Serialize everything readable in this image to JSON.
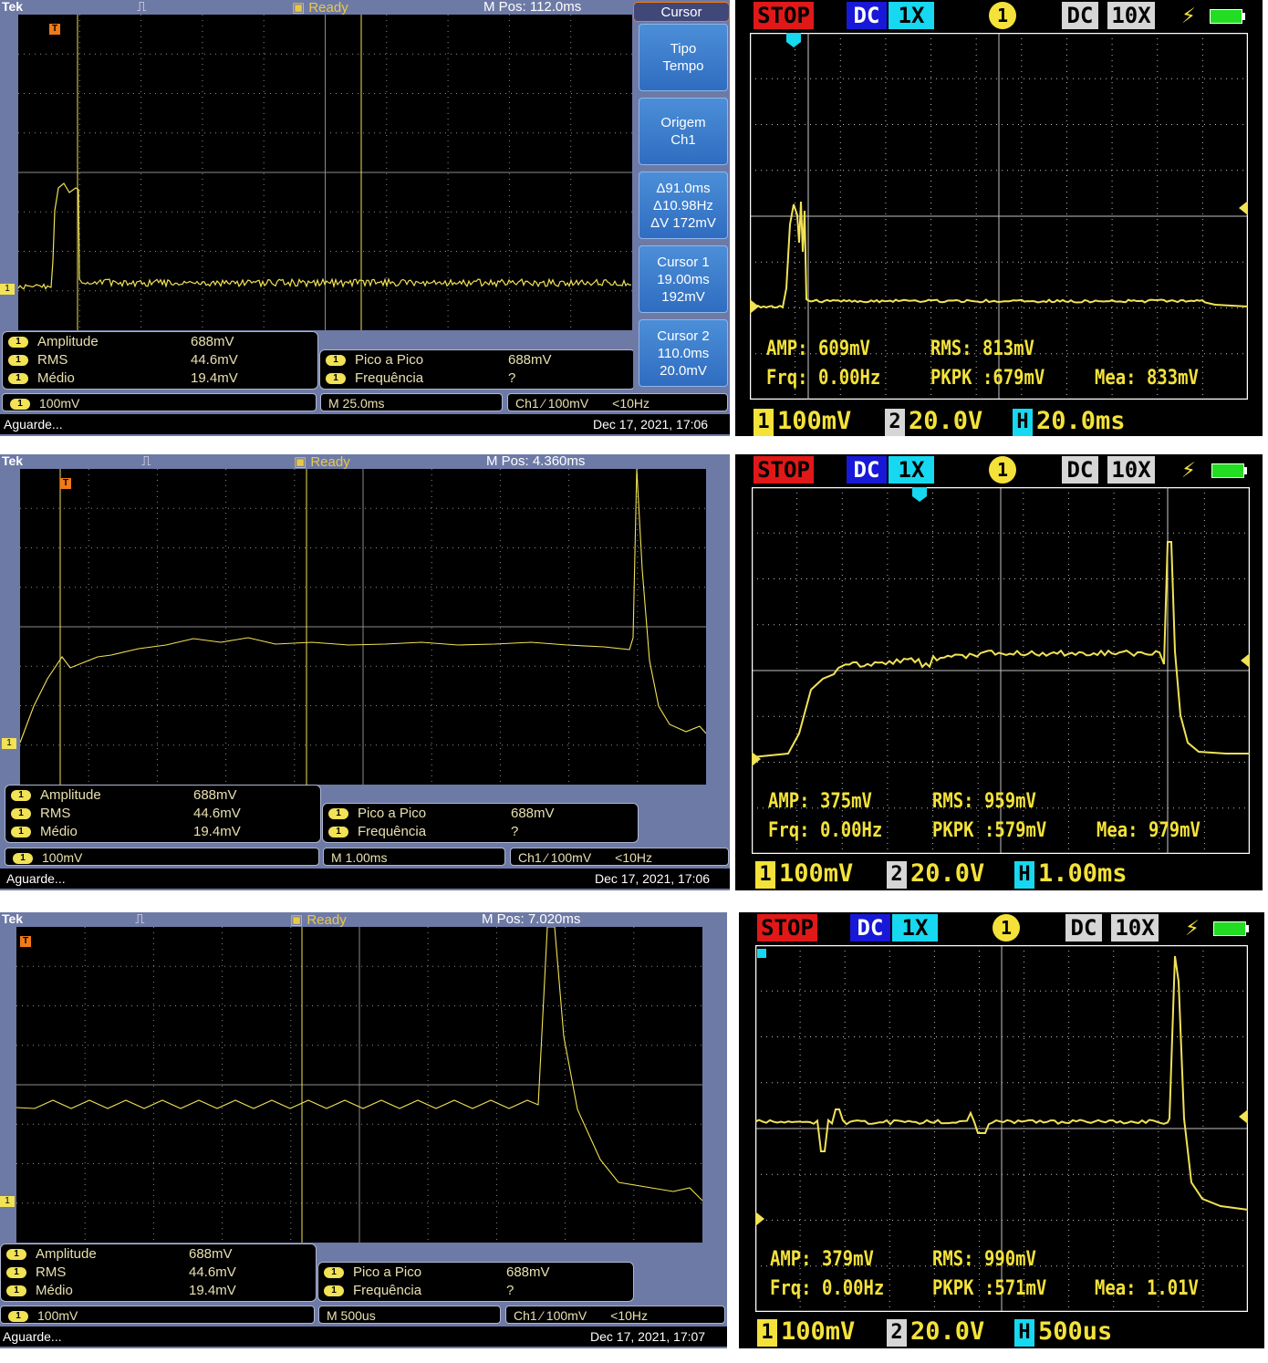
{
  "colors": {
    "trace": "#f1e256",
    "tek_frame": "#6e7aa6",
    "cursor_orange": "#f07a18",
    "dso_stop": "#e01818",
    "dso_dc": "#1818d8",
    "dso_x1": "#16d8f0"
  },
  "tek_shared": {
    "brand": "Tek",
    "trigger_state": "Ready",
    "ch1_marker": "1",
    "trigger_marker": "T",
    "measurements": [
      {
        "ch": "1",
        "label": "Amplitude",
        "value": "688mV"
      },
      {
        "ch": "1",
        "label": "RMS",
        "value": "44.6mV"
      },
      {
        "ch": "1",
        "label": "Médio",
        "value": "19.4mV"
      }
    ],
    "measurements2": [
      {
        "ch": "1",
        "label": "Pico a Pico",
        "value": "688mV"
      },
      {
        "ch": "1",
        "label": "Frequência",
        "value": "?"
      }
    ],
    "ch1_scale": "100mV",
    "trigger_info": "Ch1 ⁄ 100mV",
    "trigger_freq": "<10Hz",
    "status_msg": "Aguarde..."
  },
  "tek_panels": [
    {
      "mpos": "M Pos: 112.0ms",
      "timebase": "M 25.0ms",
      "datetime": "Dec 17, 2021, 17:06"
    },
    {
      "mpos": "M Pos: 4.360ms",
      "timebase": "M 1.00ms",
      "datetime": "Dec 17, 2021, 17:06"
    },
    {
      "mpos": "M Pos: 7.020ms",
      "timebase": "M 500us",
      "datetime": "Dec 17, 2021, 17:07"
    }
  ],
  "cursor_menu": {
    "title": "Cursor",
    "type": [
      "Tipo",
      "Tempo"
    ],
    "source": [
      "Origem",
      "Ch1"
    ],
    "delta": [
      "Δ91.0ms",
      "Δ10.98Hz",
      "ΔV 172mV"
    ],
    "cursor1": [
      "Cursor 1",
      "19.00ms",
      "192mV"
    ],
    "cursor2": [
      "Cursor 2",
      "110.0ms",
      "20.0mV"
    ]
  },
  "dso_shared": {
    "stop": "STOP",
    "coupling": "DC",
    "probe": "1X",
    "channel": "1",
    "coupling2": "DC",
    "probe2": "10X",
    "trigger_edge": "⚡",
    "ch1_box": "1",
    "ch2_box": "2",
    "h_box": "H"
  },
  "dso_panels": [
    {
      "amp": "AMP: 609mV",
      "rms": "RMS: 813mV",
      "frq": "Frq: 0.00Hz",
      "pkpk": "PKPK :679mV",
      "mea": "Mea: 833mV",
      "ch1": "100mV",
      "ch2": "20.0V",
      "h": "20.0ms"
    },
    {
      "amp": "AMP: 375mV",
      "rms": "RMS: 959mV",
      "frq": "Frq: 0.00Hz",
      "pkpk": "PKPK :579mV",
      "mea": "Mea: 979mV",
      "ch1": "100mV",
      "ch2": "20.0V",
      "h": "1.00ms"
    },
    {
      "amp": "AMP: 379mV",
      "rms": "RMS: 990mV",
      "frq": "Frq: 0.00Hz",
      "pkpk": "PKPK :571mV",
      "mea": "Mea: 1.01V",
      "ch1": "100mV",
      "ch2": "20.0V",
      "h": "500us"
    }
  ]
}
